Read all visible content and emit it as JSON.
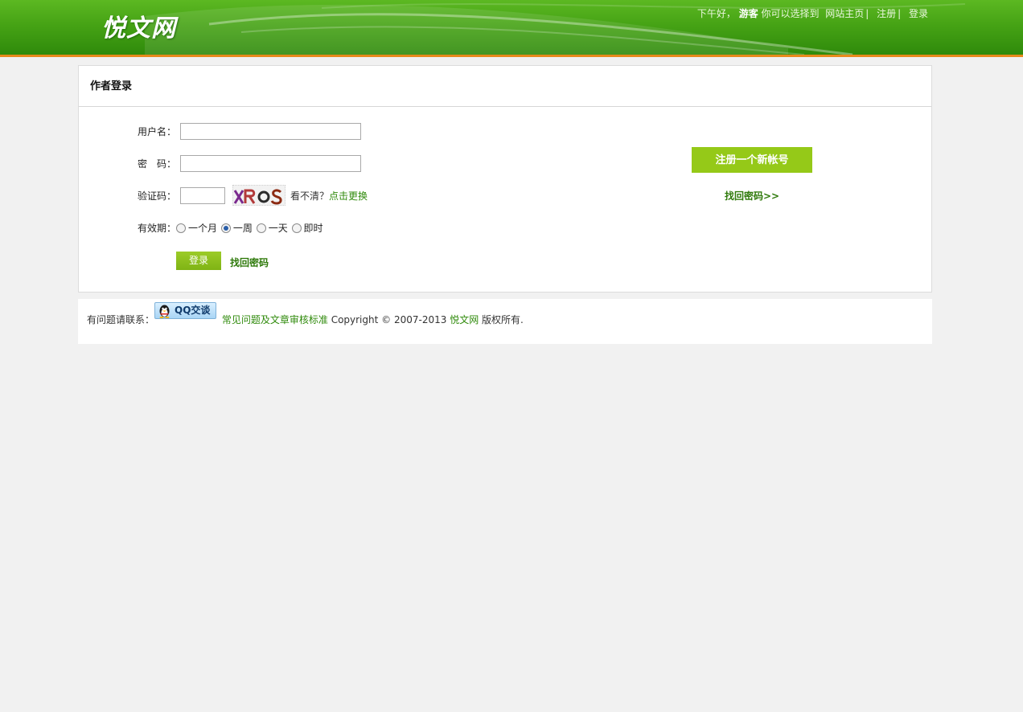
{
  "header": {
    "logo": "悦文网",
    "greeting": "下午好，",
    "user": "游客",
    "choose_text": "你可以选择到",
    "links": [
      "网站主页",
      "注册",
      "登录"
    ]
  },
  "panel": {
    "title": "作者登录",
    "username_label": "用户名：",
    "password_label": "密　码：",
    "captcha_label": "验证码：",
    "captcha_image_text": "XROS",
    "captcha_hint": "看不清？",
    "captcha_refresh": "点击更换",
    "validity_label": "有效期：",
    "validity_options": [
      "一个月",
      "一周",
      "一天",
      "即时"
    ],
    "validity_selected": "一周",
    "login_button": "登录",
    "find_password": "找回密码",
    "register_button": "注册一个新帐号",
    "find_password_right": "找回密码>>"
  },
  "footer": {
    "contact_label": "有问题请联系：",
    "qq_button": "QQ交谈",
    "faq_link": "常见问题及文章审核标准",
    "copyright": "Copyright © 2007-2013",
    "site_link": "悦文网",
    "rights": "版权所有."
  },
  "colors": {
    "header_green": "#46a315",
    "header_border": "#e88a1c",
    "accent_button": "#95c918",
    "link_green": "#2f8a0b"
  }
}
